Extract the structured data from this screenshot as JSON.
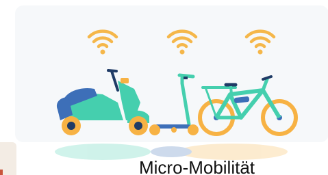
{
  "page": {
    "title": "Micro-Mobilität"
  },
  "illustration": {
    "icons": [
      "wifi-icon",
      "wifi-icon",
      "wifi-icon",
      "scooter-icon",
      "kick-scooter-icon",
      "bicycle-icon"
    ],
    "colors": {
      "wifi": "#f5b74a",
      "teal": "#45cfae",
      "blue": "#3d6fb8",
      "orange": "#f7b244",
      "background": "#f6f8fa"
    }
  }
}
